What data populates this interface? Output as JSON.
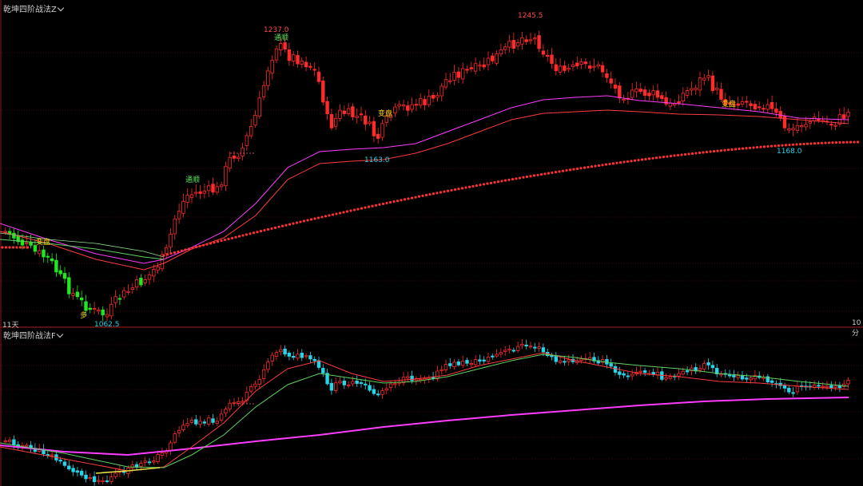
{
  "panels": {
    "top": {
      "title": "乾坤四阶战法Z"
    },
    "bottom": {
      "title": "乾坤四阶战法F"
    }
  },
  "axis": {
    "left_label": "11天",
    "right_label": "10分"
  },
  "annotations": {
    "high_1": "1237.0",
    "high_2": "1245.5",
    "low_1": "1062.5",
    "low_2": "1163.0",
    "low_3": "1168.0",
    "signal_tongshun_1": "通顺",
    "signal_tongshun_2": "通顺",
    "signal_biandian_1": "变盘",
    "signal_biandian_2": "变盘",
    "signal_biandian_3": "变盘",
    "signal_duo": "多"
  },
  "colors": {
    "background": "#000000",
    "up": "#ff2a2a",
    "down": "#1fe81f",
    "down_lower": "#27d4e8",
    "ma_magenta": "#ff3cff",
    "ma_red": "#ff3b3b",
    "ma_green": "#5fd35f",
    "grid": "#7a1414",
    "label_yellow": "#ffd400",
    "label_cyan": "#29d3e6",
    "label_red": "#ff4a4a"
  }
}
